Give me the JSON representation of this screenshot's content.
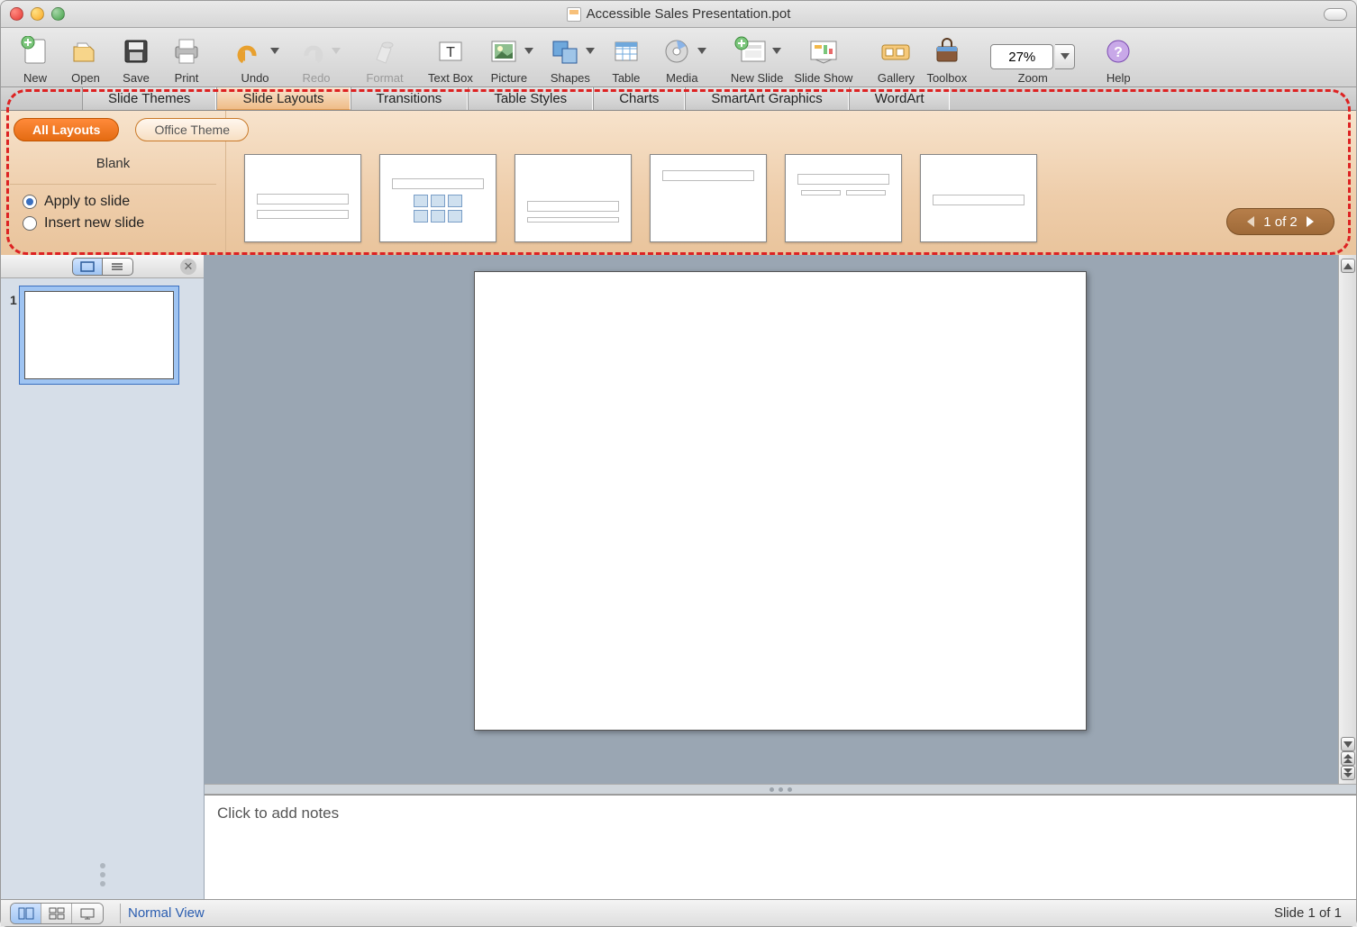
{
  "window": {
    "title": "Accessible Sales Presentation.pot"
  },
  "toolbar": {
    "new": "New",
    "open": "Open",
    "save": "Save",
    "print": "Print",
    "undo": "Undo",
    "redo": "Redo",
    "format": "Format",
    "textbox": "Text Box",
    "picture": "Picture",
    "shapes": "Shapes",
    "table": "Table",
    "media": "Media",
    "newslide": "New Slide",
    "slideshow": "Slide Show",
    "gallery": "Gallery",
    "toolbox": "Toolbox",
    "zoom_label": "Zoom",
    "zoom_value": "27%",
    "help": "Help"
  },
  "ribbon_tabs": {
    "themes": "Slide Themes",
    "layouts": "Slide Layouts",
    "transitions": "Transitions",
    "tablestyles": "Table Styles",
    "charts": "Charts",
    "smartart": "SmartArt Graphics",
    "wordart": "WordArt"
  },
  "layouts_panel": {
    "filter_all": "All Layouts",
    "filter_office": "Office Theme",
    "category": "Blank",
    "apply": "Apply to slide",
    "insert": "Insert new slide",
    "pager": "1 of 2"
  },
  "sidebar": {
    "slide1_num": "1"
  },
  "notes": {
    "placeholder": "Click to add notes"
  },
  "status": {
    "view": "Normal View",
    "slide_of": "Slide 1 of 1"
  }
}
